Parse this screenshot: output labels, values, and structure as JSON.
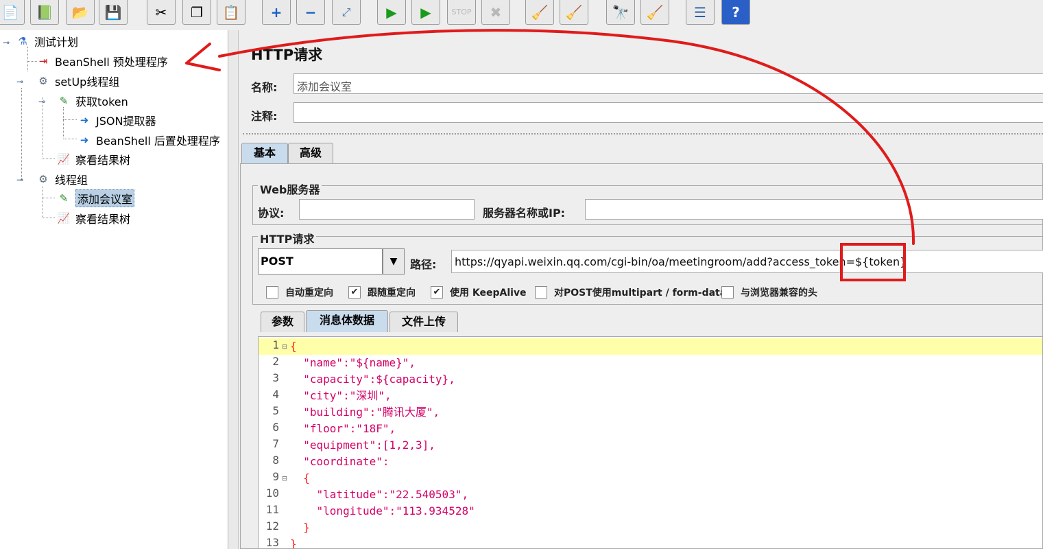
{
  "tree": {
    "root": "测试计划",
    "beanshell_pre": "BeanShell 预处理程序",
    "setup_group": "setUp线程组",
    "get_token": "获取token",
    "json_extractor": "JSON提取器",
    "beanshell_post": "BeanShell 后置处理程序",
    "results_tree_1": "察看结果树",
    "thread_group": "线程组",
    "add_room": "添加会议室",
    "results_tree_2": "察看结果树"
  },
  "panel": {
    "title": "HTTP请求",
    "name_label": "名称:",
    "name_value": "添加会议室",
    "comment_label": "注释:",
    "comment_value": "",
    "tabs": [
      "基本",
      "高级"
    ],
    "web_server": {
      "title": "Web服务器",
      "protocol_label": "协议:",
      "protocol_value": "",
      "server_label": "服务器名称或IP:",
      "server_value": ""
    },
    "http_request": {
      "title": "HTTP请求",
      "method": "POST",
      "path_label": "路径:",
      "path_value": "https://qyapi.weixin.qq.com/cgi-bin/oa/meetingroom/add?access_token=${token}"
    },
    "checkboxes": [
      {
        "label": "自动重定向",
        "checked": false
      },
      {
        "label": "跟随重定向",
        "checked": true
      },
      {
        "label": "使用 KeepAlive",
        "checked": true
      },
      {
        "label": "对POST使用multipart / form-data",
        "checked": false
      },
      {
        "label": "与浏览器兼容的头",
        "checked": false
      }
    ],
    "sub_tabs": [
      "参数",
      "消息体数据",
      "文件上传"
    ]
  },
  "editor": {
    "line_numbers": [
      "1",
      "2",
      "3",
      "4",
      "5",
      "6",
      "7",
      "8",
      "9",
      "10",
      "11",
      "12",
      "13"
    ],
    "lines": [
      "{",
      "  \"name\":\"${name}\",",
      "  \"capacity\":${capacity},",
      "  \"city\":\"深圳\",",
      "  \"building\":\"腾讯大厦\",",
      "  \"floor\":\"18F\",",
      "  \"equipment\":[1,2,3],",
      "  \"coordinate\":",
      "  {",
      "    \"latitude\":\"22.540503\",",
      "    \"longitude\":\"113.934528\"",
      "  }",
      "}"
    ]
  },
  "toolbar_icons": [
    "new-icon",
    "templates-icon",
    "open-icon",
    "save-icon",
    "cut-icon",
    "copy-icon",
    "paste-icon",
    "expand-icon",
    "collapse-icon",
    "toggle-icon",
    "start-icon",
    "start-no-pause-icon",
    "stop-icon",
    "shutdown-icon",
    "clear-icon",
    "clear-all-icon",
    "search-icon",
    "reset-search-icon",
    "function-helper-icon",
    "help-icon"
  ],
  "colors": {
    "annotation": "#e01b1b",
    "selection": "#b8cfe5",
    "highlight_line": "#ffffaa"
  }
}
